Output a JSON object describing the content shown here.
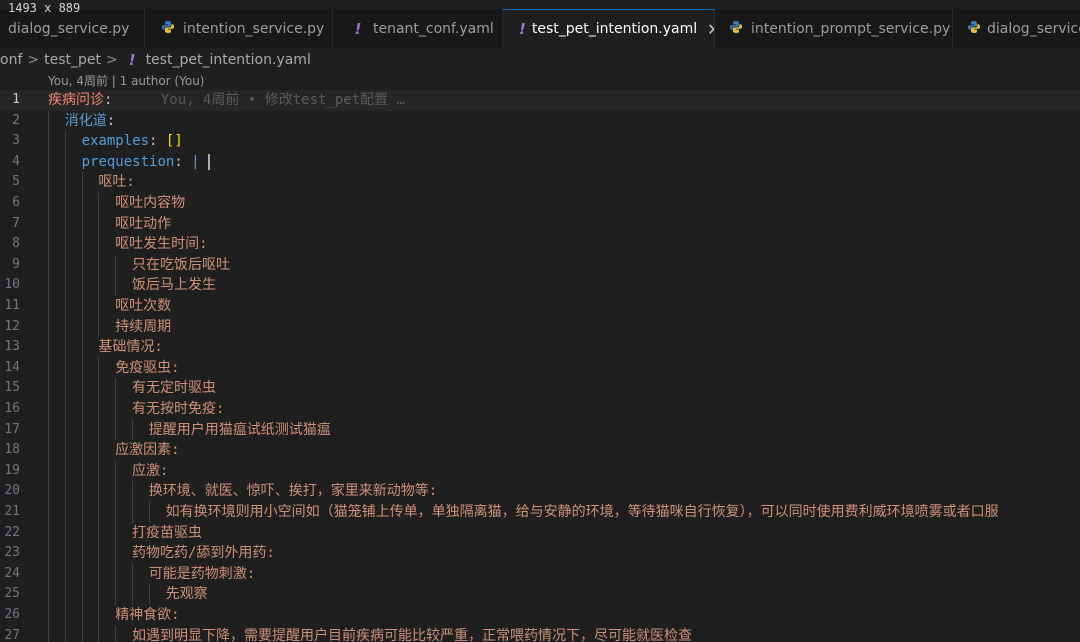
{
  "screenshot_label": "1493 x 889",
  "tabs": [
    {
      "label": "dialog_service.py",
      "type": "py",
      "active": false
    },
    {
      "label": "intention_service.py",
      "type": "py",
      "active": false
    },
    {
      "label": "tenant_conf.yaml",
      "type": "yaml",
      "active": false
    },
    {
      "label": "test_pet_intention.yaml",
      "type": "yaml",
      "active": true,
      "close": "✕"
    },
    {
      "label": "intention_prompt_service.py",
      "type": "py",
      "active": false
    },
    {
      "label": "dialog_service.",
      "type": "py",
      "active": false
    }
  ],
  "breadcrumb": {
    "items": [
      "onf",
      "test_pet",
      "test_pet_intention.yaml"
    ],
    "separator": ">",
    "yaml_glyph": "!"
  },
  "codelens": "You, 4周前 | 1 author (You)",
  "blame": "You, 4周前 • 修改test_pet配置 …",
  "icons": {
    "yaml": "yaml-file-icon",
    "python": "python-file-icon",
    "close": "close-icon"
  },
  "colors": {
    "background": "#1f1f1f",
    "tab_bar": "#181818",
    "active_tab_border": "#0078d4",
    "yaml_icon": "#a074c4",
    "key_red": "#f48771",
    "key_blue": "#569cd6",
    "value_orange": "#ce9178"
  },
  "lines": [
    {
      "n": "1",
      "indent": 0,
      "text": "疾病问诊",
      "kind": "key-red",
      "colon": true,
      "current": true
    },
    {
      "n": "2",
      "indent": 1,
      "text": "消化道",
      "kind": "key-blue",
      "colon": true
    },
    {
      "n": "3",
      "indent": 2,
      "text": "examples",
      "kind": "key-blue",
      "colon": true,
      "value": "[]",
      "value_kind": "bracket"
    },
    {
      "n": "4",
      "indent": 2,
      "text": "prequestion",
      "kind": "key-blue",
      "colon": true,
      "value": "|",
      "value_kind": "pipe",
      "cursor": true
    },
    {
      "n": "5",
      "indent": 3,
      "text": "呕吐:",
      "kind": "val-orange"
    },
    {
      "n": "6",
      "indent": 4,
      "text": "呕吐内容物",
      "kind": "val-orange"
    },
    {
      "n": "7",
      "indent": 4,
      "text": "呕吐动作",
      "kind": "val-orange"
    },
    {
      "n": "8",
      "indent": 4,
      "text": "呕吐发生时间:",
      "kind": "val-orange"
    },
    {
      "n": "9",
      "indent": 5,
      "text": "只在吃饭后呕吐",
      "kind": "val-orange"
    },
    {
      "n": "10",
      "indent": 5,
      "text": "饭后马上发生",
      "kind": "val-orange"
    },
    {
      "n": "11",
      "indent": 4,
      "text": "呕吐次数",
      "kind": "val-orange"
    },
    {
      "n": "12",
      "indent": 4,
      "text": "持续周期",
      "kind": "val-orange"
    },
    {
      "n": "13",
      "indent": 3,
      "text": "基础情况:",
      "kind": "val-orange"
    },
    {
      "n": "14",
      "indent": 4,
      "text": "免疫驱虫:",
      "kind": "val-orange"
    },
    {
      "n": "15",
      "indent": 5,
      "text": "有无定时驱虫",
      "kind": "val-orange"
    },
    {
      "n": "16",
      "indent": 5,
      "text": "有无按时免疫:",
      "kind": "val-orange"
    },
    {
      "n": "17",
      "indent": 6,
      "text": "提醒用户用猫瘟试纸测试猫瘟",
      "kind": "val-orange"
    },
    {
      "n": "18",
      "indent": 4,
      "text": "应激因素:",
      "kind": "val-orange"
    },
    {
      "n": "19",
      "indent": 5,
      "text": "应激:",
      "kind": "val-orange"
    },
    {
      "n": "20",
      "indent": 6,
      "text": "换环境、就医、惊吓、挨打，家里来新动物等:",
      "kind": "val-orange"
    },
    {
      "n": "21",
      "indent": 7,
      "text": "如有换环境则用小空间如（猫笼铺上传单，单独隔离猫，给与安静的环境，等待猫咪自行恢复），可以同时使用费利威环境喷雾或者口服",
      "kind": "val-orange"
    },
    {
      "n": "22",
      "indent": 5,
      "text": "打疫苗驱虫",
      "kind": "val-orange"
    },
    {
      "n": "23",
      "indent": 5,
      "text": "药物吃药/舔到外用药:",
      "kind": "val-orange"
    },
    {
      "n": "24",
      "indent": 6,
      "text": "可能是药物刺激:",
      "kind": "val-orange"
    },
    {
      "n": "25",
      "indent": 7,
      "text": "先观察",
      "kind": "val-orange"
    },
    {
      "n": "26",
      "indent": 4,
      "text": "精神食欲:",
      "kind": "val-orange"
    },
    {
      "n": "27",
      "indent": 5,
      "text": "如遇到明显下降，需要提醒用户目前疾病可能比较严重，正常喂药情况下，尽可能就医检查",
      "kind": "val-orange"
    }
  ]
}
